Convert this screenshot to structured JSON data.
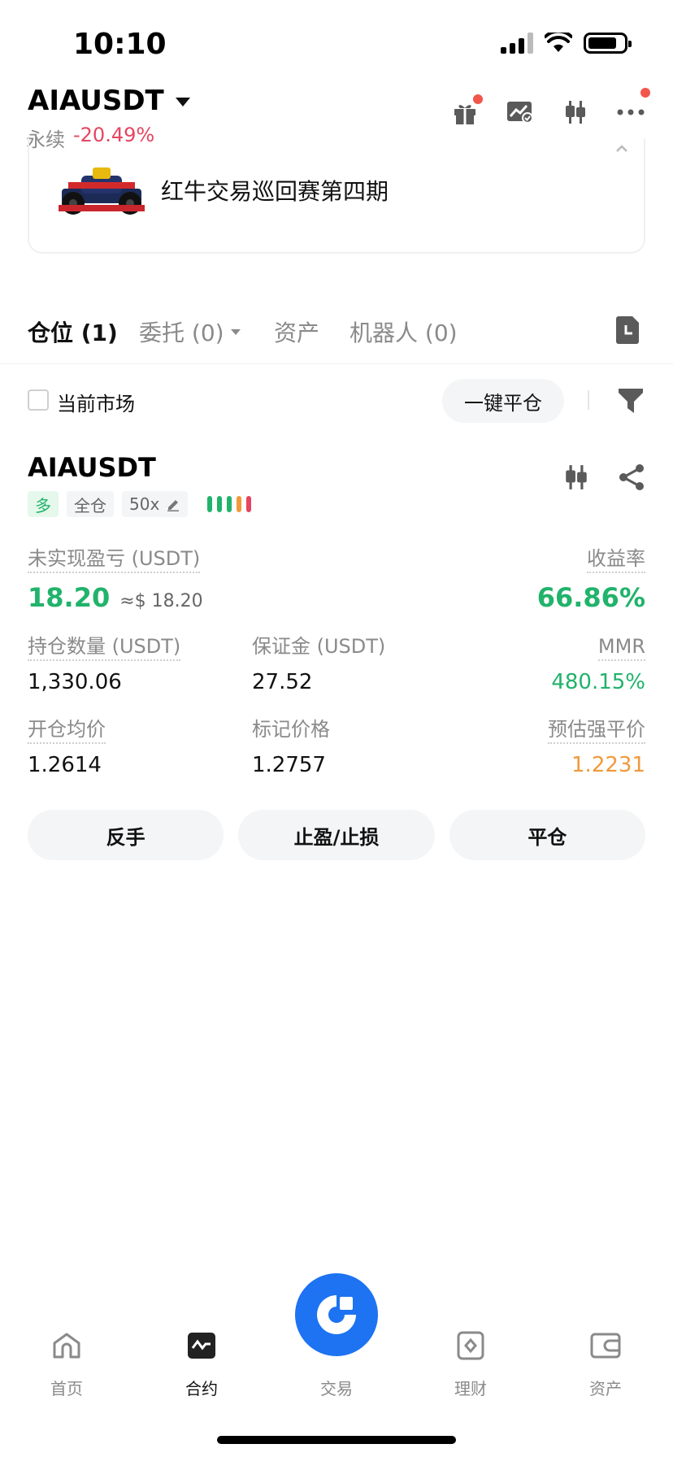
{
  "status_bar": {
    "time": "10:10"
  },
  "header": {
    "pair": "AIAUSDT",
    "type": "永续",
    "change": "-20.49%",
    "icons": [
      "gift-icon",
      "chart-check-icon",
      "candlestick-icon",
      "more-icon"
    ]
  },
  "banner": {
    "text": "红牛交易巡回赛第四期"
  },
  "tabs": [
    {
      "label": "仓位 (1)"
    },
    {
      "label": "委托 (0)"
    },
    {
      "label": "资产"
    },
    {
      "label": "机器人 (0)"
    }
  ],
  "filter": {
    "current_market_label": "当前市场",
    "close_all_label": "一键平仓"
  },
  "position": {
    "symbol": "AIAUSDT",
    "side": "多",
    "margin_mode": "全仓",
    "leverage": "50x",
    "risk_level_bars": 5,
    "unrealized_pnl_label": "未实现盈亏 (USDT)",
    "unrealized_pnl": "18.20",
    "unrealized_pnl_usd": "≈$ 18.20",
    "roe_label": "收益率",
    "roe": "66.86%",
    "size_label": "持仓数量 (USDT)",
    "size": "1,330.06",
    "margin_label": "保证金 (USDT)",
    "margin": "27.52",
    "mmr_label": "MMR",
    "mmr": "480.15%",
    "entry_price_label": "开仓均价",
    "entry_price": "1.2614",
    "mark_price_label": "标记价格",
    "mark_price": "1.2757",
    "liq_price_label": "预估强平价",
    "liq_price": "1.2231",
    "actions": {
      "reverse": "反手",
      "tpsl": "止盈/止损",
      "close": "平仓"
    }
  },
  "bottom_nav": {
    "home": "首页",
    "futures": "合约",
    "trade": "交易",
    "earn": "理财",
    "assets": "资产"
  },
  "colors": {
    "green": "#21b36b",
    "red": "#e64561",
    "orange": "#f09a3c",
    "brand_blue": "#1d73f2"
  }
}
